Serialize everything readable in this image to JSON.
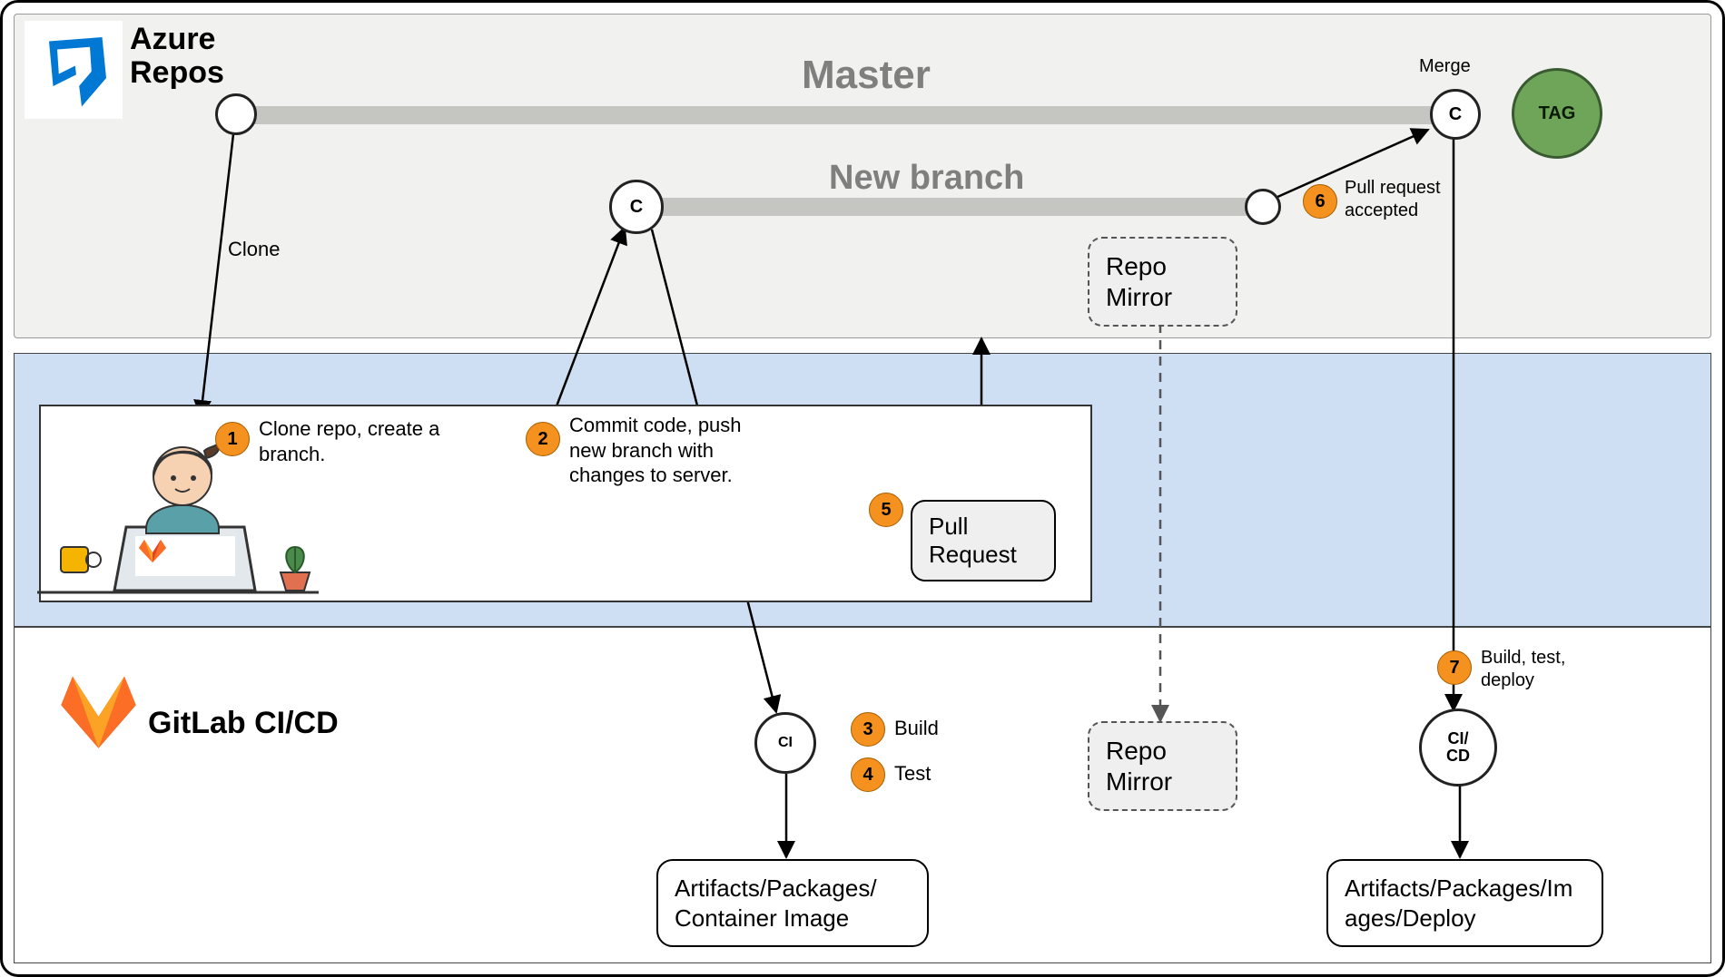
{
  "azure": {
    "title_line1": "Azure",
    "title_line2": "Repos",
    "branch_master": "Master",
    "branch_new": "New branch",
    "merge_label": "Merge",
    "tag_label": "TAG",
    "node_c": "C",
    "clone_label": "Clone",
    "repo_mirror": "Repo\nMirror"
  },
  "gitlab": {
    "title": "GitLab CI/CD",
    "ci_label": "CI",
    "cicd_label": "CI/\nCD",
    "artifacts1": "Artifacts/Packages/\nContainer Image",
    "artifacts2": "Artifacts/Packages/Im\nages/Deploy",
    "repo_mirror": "Repo\nMirror"
  },
  "steps": {
    "s1": {
      "num": "1",
      "text": "Clone repo, create a\nbranch."
    },
    "s2": {
      "num": "2",
      "text": "Commit code, push\nnew branch with\nchanges to server."
    },
    "s3": {
      "num": "3",
      "text": "Build"
    },
    "s4": {
      "num": "4",
      "text": "Test"
    },
    "s5": {
      "num": "5",
      "text": "Pull\nRequest"
    },
    "s6": {
      "num": "6",
      "text": "Pull request\naccepted"
    },
    "s7": {
      "num": "7",
      "text": "Build, test,\ndeploy"
    }
  }
}
